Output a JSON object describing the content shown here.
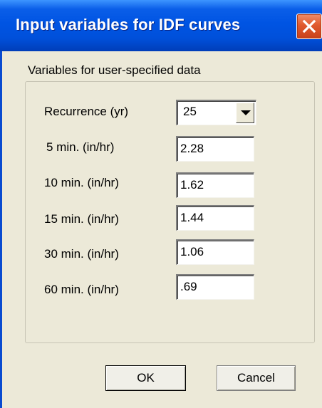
{
  "window": {
    "title": "Input variables for IDF curves",
    "colors": {
      "titlebar": "#0054E3",
      "background": "#ECE9D8",
      "close": "#E05A2E"
    }
  },
  "group": {
    "label": "Variables for user-specified data"
  },
  "recurrence": {
    "label": "Recurrence (yr)",
    "value": "25"
  },
  "rows": [
    {
      "label": " 5 min. (in/hr)",
      "value": "2.28"
    },
    {
      "label": "10 min. (in/hr)",
      "value": "1.62"
    },
    {
      "label": "15 min. (in/hr)",
      "value": "1.44"
    },
    {
      "label": "30 min. (in/hr)",
      "value": "1.06"
    },
    {
      "label": "60 min. (in/hr)",
      "value": ".69"
    }
  ],
  "buttons": {
    "ok": "OK",
    "cancel": "Cancel"
  },
  "icons": {
    "close": "close-icon",
    "dropdown": "chevron-down-icon"
  }
}
